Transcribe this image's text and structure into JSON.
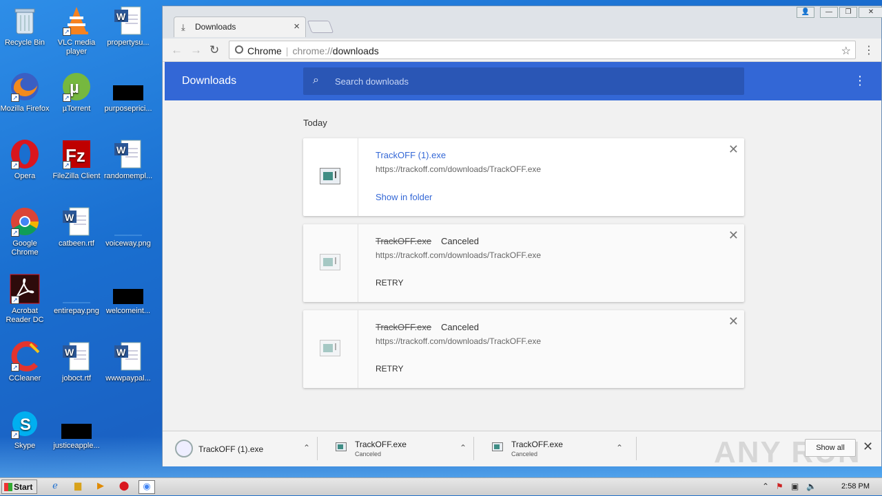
{
  "desktop": {
    "icons": [
      {
        "label": "Recycle Bin"
      },
      {
        "label": "VLC media player"
      },
      {
        "label": "propertysu..."
      },
      {
        "label": "Mozilla Firefox"
      },
      {
        "label": "µTorrent"
      },
      {
        "label": "purposeprici..."
      },
      {
        "label": "Opera"
      },
      {
        "label": "FileZilla Client"
      },
      {
        "label": "randomempl..."
      },
      {
        "label": "Google Chrome"
      },
      {
        "label": "catbeen.rtf"
      },
      {
        "label": "voiceway.png"
      },
      {
        "label": "Acrobat Reader DC"
      },
      {
        "label": "entirepay.png"
      },
      {
        "label": "welcomeint..."
      },
      {
        "label": "CCleaner"
      },
      {
        "label": "joboct.rtf"
      },
      {
        "label": "wwwpaypal..."
      },
      {
        "label": "Skype"
      },
      {
        "label": "justiceapple..."
      }
    ]
  },
  "browser": {
    "tab_title": "Downloads",
    "omnibox": {
      "site_label": "Chrome",
      "scheme": "chrome://",
      "path": "downloads"
    }
  },
  "downloads_page": {
    "title": "Downloads",
    "search_placeholder": "Search downloads",
    "section_label": "Today",
    "items": [
      {
        "filename": "TrackOFF (1).exe",
        "status": "",
        "url": "https://trackoff.com/downloads/TrackOFF.exe",
        "action": "Show in folder"
      },
      {
        "filename": "TrackOFF.exe",
        "status": "Canceled",
        "url": "https://trackoff.com/downloads/TrackOFF.exe",
        "action": "RETRY"
      },
      {
        "filename": "TrackOFF.exe",
        "status": "Canceled",
        "url": "https://trackoff.com/downloads/TrackOFF.exe",
        "action": "RETRY"
      }
    ]
  },
  "shelf": {
    "items": [
      {
        "filename": "TrackOFF (1).exe",
        "sub": ""
      },
      {
        "filename": "TrackOFF.exe",
        "sub": "Canceled"
      },
      {
        "filename": "TrackOFF.exe",
        "sub": "Canceled"
      }
    ],
    "show_all": "Show all",
    "watermark": "ANY RUN"
  },
  "taskbar": {
    "start_label": "Start",
    "clock": "2:58 PM"
  },
  "colors": {
    "accent": "#3367d6",
    "search_bg": "#2a56b5",
    "desktop_bg": "#1a6fd0"
  }
}
